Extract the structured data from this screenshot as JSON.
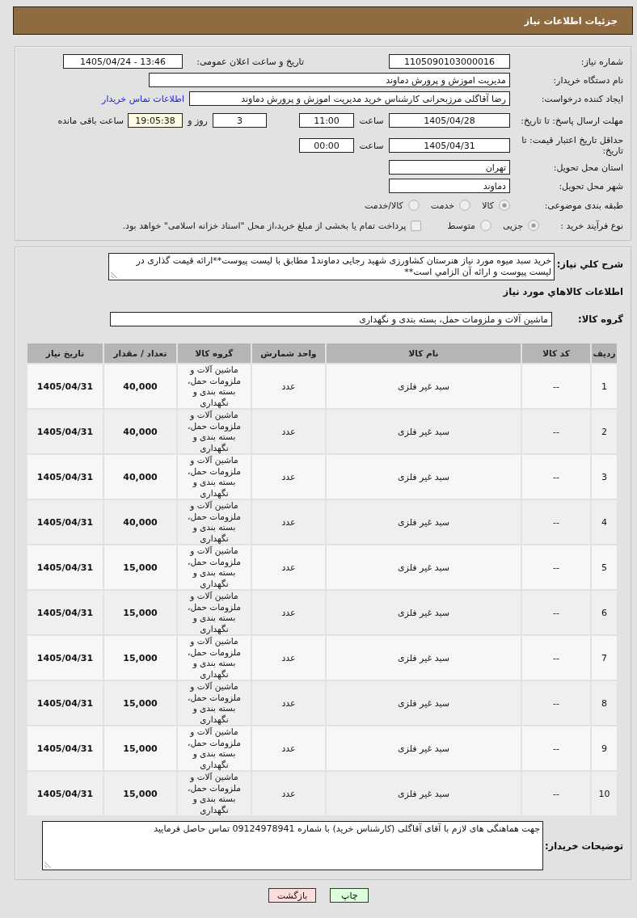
{
  "header": {
    "title": "جزئیات اطلاعات نیاز"
  },
  "need_number": {
    "label": "شماره نیاز:",
    "value": "1105090103000016"
  },
  "announce_datetime": {
    "label": "تاریخ و ساعت اعلان عمومی:",
    "value": "1405/04/24 - 13:46"
  },
  "buyer_org": {
    "label": "نام دستگاه خریدار:",
    "value": "مدیریت اموزش و پرورش دماوند"
  },
  "requester": {
    "label": "ایجاد کننده درخواست:",
    "value": "رضا آقاگلی مرزبحرانی کارشناس خرید مدیریت اموزش و پرورش دماوند",
    "link": "اطلاعات تماس خریدار"
  },
  "response_deadline": {
    "label": "مهلت ارسال پاسخ: تا تاریخ:",
    "date": "1405/04/28",
    "time_label": "ساعت",
    "time": "11:00",
    "days": "3",
    "days_label": "روز و",
    "remaining": "19:05:38",
    "remaining_label": "ساعت باقی مانده"
  },
  "price_validity": {
    "label": "حداقل تاریخ اعتبار قیمت: تا تاریخ:",
    "date": "1405/04/31",
    "time_label": "ساعت",
    "time": "00:00"
  },
  "delivery_province": {
    "label": "استان محل تحویل:",
    "value": "تهران"
  },
  "delivery_city": {
    "label": "شهر محل تحویل:",
    "value": "دماوند"
  },
  "subject_category": {
    "label": "طبقه بندی موضوعی:",
    "options": [
      {
        "label": "کالا",
        "selected": true
      },
      {
        "label": "خدمت",
        "selected": false
      },
      {
        "label": "کالا/خدمت",
        "selected": false
      }
    ]
  },
  "purchase_process": {
    "label": "نوع فرآیند خرید :",
    "options": [
      {
        "label": "جزیی",
        "selected": true
      },
      {
        "label": "متوسط",
        "selected": false
      }
    ],
    "treasury": {
      "label": "پرداخت تمام یا بخشی از مبلغ خرید،از محل \"اسناد خزانه اسلامی\" خواهد بود.",
      "checked": false
    }
  },
  "description": {
    "label": "شرح کلي نیاز:",
    "text": "خرید سبد میوه مورد نیاز هنرستان کشاورزی شهید رجایی دماوند1 مطابق با لیست پیوست**ارائه قیمت گذاری در لیست پیوست و ارائه آن الزامي است**"
  },
  "goods_title": "اطلاعات کالاهاي مورد نیاز",
  "goods_group": {
    "label": "گروه کالا:",
    "value": "ماشین آلات و ملزومات حمل، بسته بندی و نگهداری"
  },
  "table": {
    "columns": [
      "ردیف",
      "کد کالا",
      "نام کالا",
      "واحد شمارش",
      "گروه کالا",
      "تعداد / مقدار",
      "تاریخ نیاز"
    ],
    "rows": [
      {
        "number": "1",
        "code": "--",
        "name": "سبد غیر فلزی",
        "unit": "عدد",
        "group": "ماشین آلات و ملزومات حمل، بسته بندی و نگهداری",
        "quantity": "40,000",
        "need_date": "1405/04/31"
      },
      {
        "number": "2",
        "code": "--",
        "name": "سبد غیر فلزی",
        "unit": "عدد",
        "group": "ماشین آلات و ملزومات حمل، بسته بندی و نگهداری",
        "quantity": "40,000",
        "need_date": "1405/04/31"
      },
      {
        "number": "3",
        "code": "--",
        "name": "سبد غیر فلزی",
        "unit": "عدد",
        "group": "ماشین آلات و ملزومات حمل، بسته بندی و نگهداری",
        "quantity": "40,000",
        "need_date": "1405/04/31"
      },
      {
        "number": "4",
        "code": "--",
        "name": "سبد غیر فلزی",
        "unit": "عدد",
        "group": "ماشین آلات و ملزومات حمل، بسته بندی و نگهداری",
        "quantity": "40,000",
        "need_date": "1405/04/31"
      },
      {
        "number": "5",
        "code": "--",
        "name": "سبد غیر فلزی",
        "unit": "عدد",
        "group": "ماشین آلات و ملزومات حمل، بسته بندی و نگهداری",
        "quantity": "15,000",
        "need_date": "1405/04/31"
      },
      {
        "number": "6",
        "code": "--",
        "name": "سبد غیر فلزی",
        "unit": "عدد",
        "group": "ماشین آلات و ملزومات حمل، بسته بندی و نگهداری",
        "quantity": "15,000",
        "need_date": "1405/04/31"
      },
      {
        "number": "7",
        "code": "--",
        "name": "سبد غیر فلزی",
        "unit": "عدد",
        "group": "ماشین آلات و ملزومات حمل، بسته بندی و نگهداری",
        "quantity": "15,000",
        "need_date": "1405/04/31"
      },
      {
        "number": "8",
        "code": "--",
        "name": "سبد غیر فلزی",
        "unit": "عدد",
        "group": "ماشین آلات و ملزومات حمل، بسته بندی و نگهداری",
        "quantity": "15,000",
        "need_date": "1405/04/31"
      },
      {
        "number": "9",
        "code": "--",
        "name": "سبد غیر فلزی",
        "unit": "عدد",
        "group": "ماشین آلات و ملزومات حمل، بسته بندی و نگهداری",
        "quantity": "15,000",
        "need_date": "1405/04/31"
      },
      {
        "number": "10",
        "code": "--",
        "name": "سبد غیر فلزی",
        "unit": "عدد",
        "group": "ماشین آلات و ملزومات حمل، بسته بندی و نگهداری",
        "quantity": "15,000",
        "need_date": "1405/04/31"
      }
    ]
  },
  "buyer_notes": {
    "label": "توضیحات خریدار:",
    "text": "جهت هماهنگی های لازم با آقای آقاگلی (کارشناس خرید) با شماره 09124978941 تماس حاصل فرمایید"
  },
  "buttons": [
    {
      "label": "چاپ",
      "kind": "print"
    },
    {
      "label": "بازگشت",
      "kind": "back"
    }
  ]
}
